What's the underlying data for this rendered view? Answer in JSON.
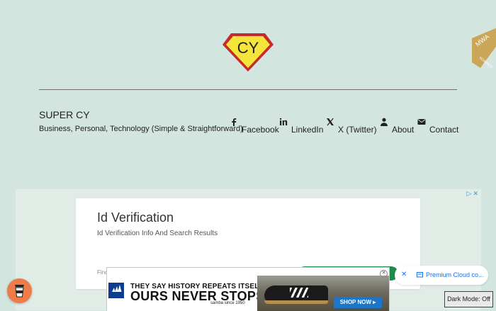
{
  "logo": {
    "text": "CY",
    "colors": {
      "fill": "#f5e53b",
      "border": "#c62a2a",
      "text": "#222222"
    }
  },
  "award_ribbon": {
    "line1": "MWA",
    "line2": "NOMINEE",
    "color": "#caa658"
  },
  "site": {
    "title": "SUPER CY",
    "tagline": "Business, Personal, Technology (Simple & Straightforward)"
  },
  "nav": [
    {
      "icon": "facebook-icon",
      "label": "Facebook"
    },
    {
      "icon": "linkedin-icon",
      "label": "LinkedIn"
    },
    {
      "icon": "x-twitter-icon",
      "label": "X (Twitter)"
    },
    {
      "icon": "person-icon",
      "label": "About"
    },
    {
      "icon": "envelope-icon",
      "label": "Contact"
    }
  ],
  "ad_card": {
    "title": "Id Verification",
    "subtitle": "Id Verification Info And Search Results",
    "find_text": "Find"
  },
  "bottom_ad": {
    "headline": "THEY SAY HISTORY REPEATS ITSELF",
    "subheadline": "OURS NEVER STOPS",
    "since": "samba since 1950",
    "cta": "SHOP NOW"
  },
  "cloud_notice": {
    "text": "Premium Cloud co..."
  },
  "dark_mode": {
    "label": "Dark Mode: Off"
  },
  "colors": {
    "background": "#d3e5df",
    "coffee": "#ef7b46",
    "link_blue": "#1a73e8"
  }
}
